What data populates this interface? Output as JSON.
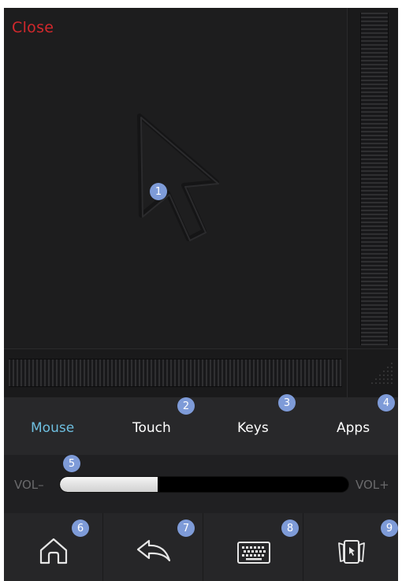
{
  "header": {
    "close_label": "Close"
  },
  "trackpad": {
    "pointer_marker": "1"
  },
  "tabs": [
    {
      "label": "Mouse",
      "marker": ""
    },
    {
      "label": "Touch",
      "marker": "2"
    },
    {
      "label": "Keys",
      "marker": "3"
    },
    {
      "label": "Apps",
      "marker": "4"
    }
  ],
  "volume": {
    "minus_label": "VOL–",
    "plus_label": "VOL+",
    "level": 0.34,
    "marker": "5"
  },
  "buttons": [
    {
      "icon": "home-icon",
      "marker": "6"
    },
    {
      "icon": "back-icon",
      "marker": "7"
    },
    {
      "icon": "keyboard-icon",
      "marker": "8"
    },
    {
      "icon": "app-cards-icon",
      "marker": "9"
    }
  ],
  "colors": {
    "close": "#d1282c",
    "active_tab": "#6ebfe0",
    "badge": "#7e9bd8",
    "background": "#1f1f20"
  }
}
